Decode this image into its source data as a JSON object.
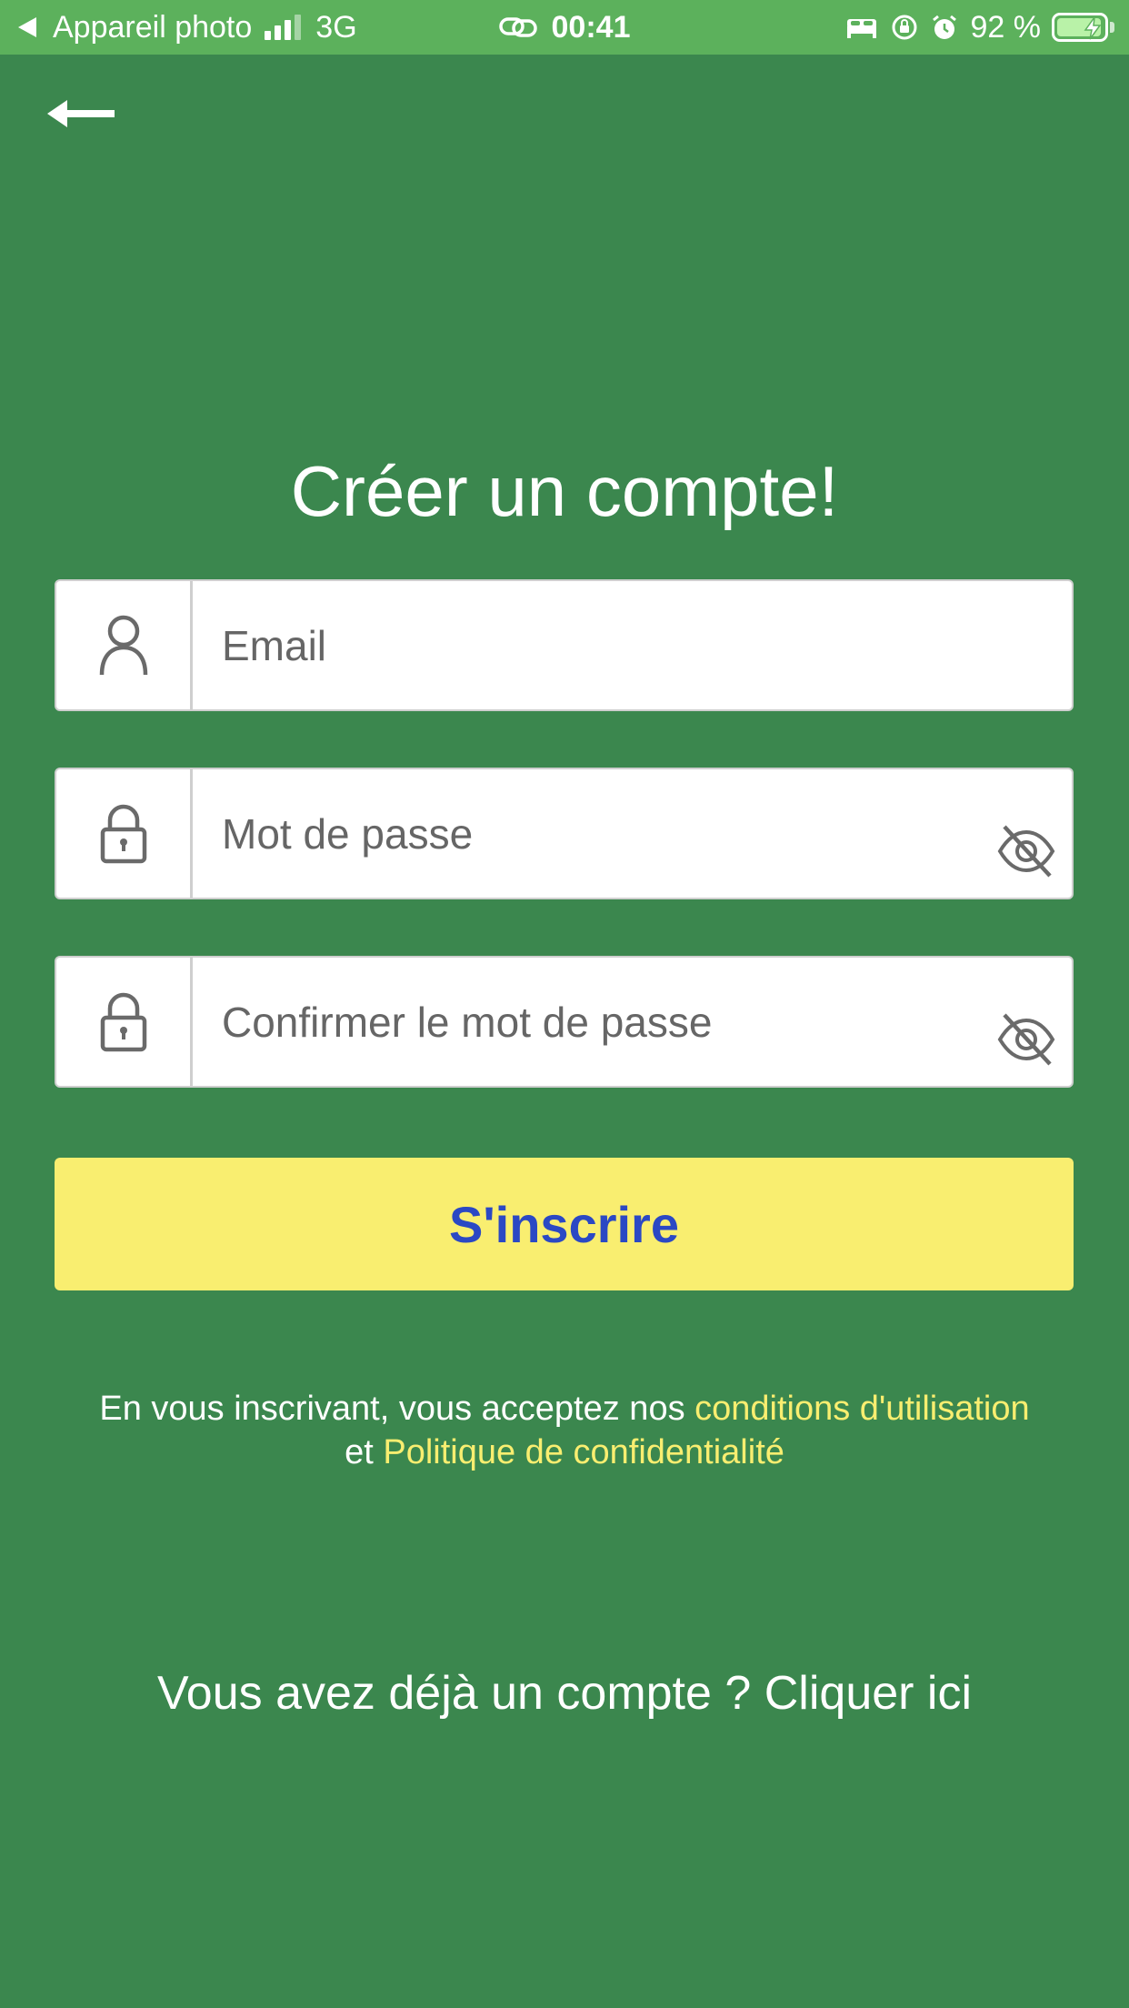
{
  "status_bar": {
    "back_app_label": "Appareil photo",
    "network": "3G",
    "time": "00:41",
    "battery_percent": "92 %",
    "battery_level": 0.92,
    "icons": [
      "back-arrow-icon",
      "signal-icon",
      "link-icon",
      "bed-icon",
      "rotation-lock-icon",
      "alarm-icon",
      "battery-charging-icon"
    ]
  },
  "header": {
    "back_icon": "arrow-left-icon"
  },
  "title": "Créer un compte!",
  "form": {
    "email": {
      "icon": "user-icon",
      "placeholder": "Email",
      "value": ""
    },
    "password": {
      "icon": "lock-icon",
      "placeholder": "Mot de passe",
      "value": "",
      "toggle_icon": "eye-slash-icon"
    },
    "confirm_password": {
      "icon": "lock-icon",
      "placeholder": "Confirmer le mot de passe",
      "value": "",
      "toggle_icon": "eye-slash-icon"
    },
    "submit_label": "S'inscrire"
  },
  "terms": {
    "prefix": "En vous inscrivant, vous acceptez nos",
    "terms_link": "conditions d'utilisation",
    "conjunction": "et",
    "privacy_link": "Politique de confidentialité"
  },
  "login_prompt": "Vous avez déjà un compte ? Cliquer ici",
  "colors": {
    "background": "#3b874e",
    "status_bar": "#5cb15c",
    "button": "#f9ee70",
    "button_text": "#2b48c4",
    "link": "#f9ee70"
  }
}
